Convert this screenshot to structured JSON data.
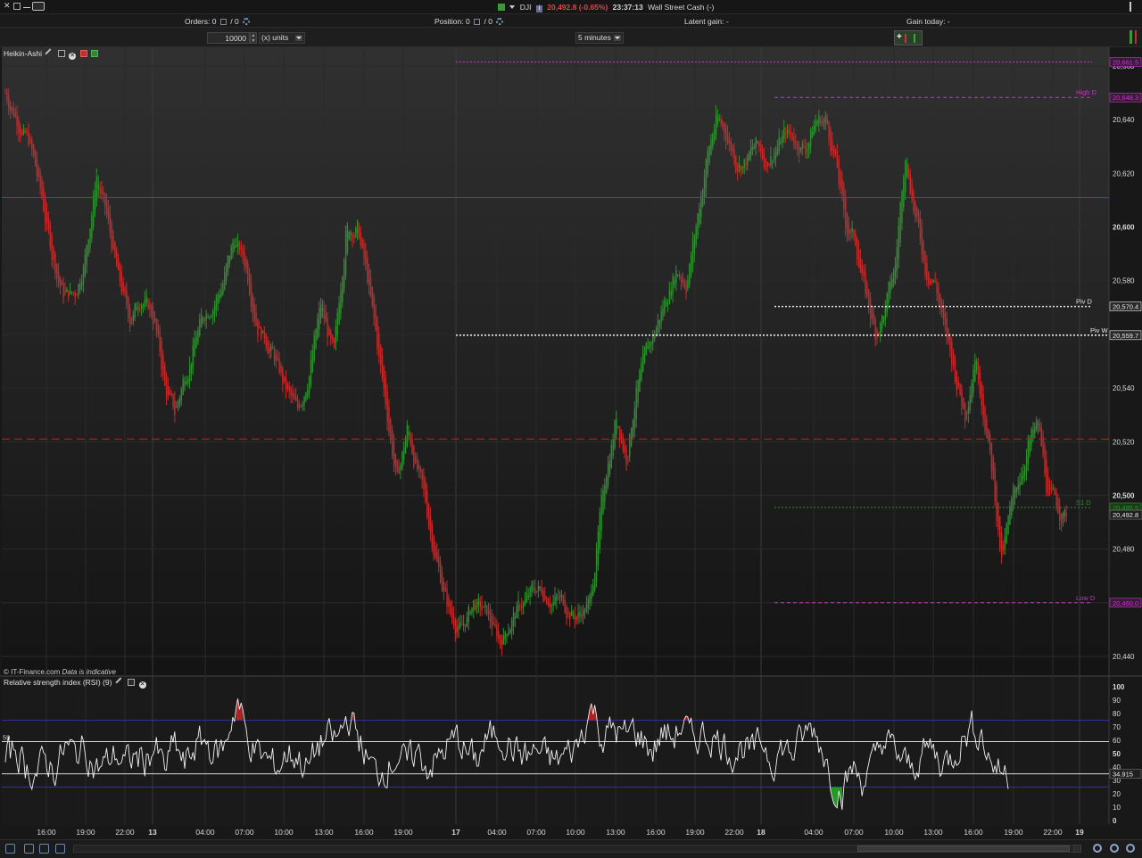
{
  "window": {
    "symbol": "DJI",
    "price_change": "20,492.8 (-0.65%)",
    "time": "23:37:13",
    "instrument": "Wall Street Cash (-)"
  },
  "infobar": {
    "orders_label": "Orders:",
    "orders_count": "0",
    "orders_pending": "0",
    "position_label": "Position:",
    "position_count": "0",
    "position_pending": "0",
    "latent_gain_label": "Latent gain:",
    "latent_gain_value": "-",
    "gain_today_label": "Gain today:",
    "gain_today_value": "-"
  },
  "toolbar": {
    "quantity": "10000",
    "units": "(x) units",
    "interval": "5 minutes"
  },
  "main_panel": {
    "title": "Heikin-Ashi",
    "credit": "© IT-Finance.com",
    "credit_note": "Data is indicative"
  },
  "rsi_panel": {
    "title": "Relative strength index (RSI) (9)",
    "level_left": "59",
    "current_value": "34.915"
  },
  "colors": {
    "up": "#2f8f2f",
    "down": "#c42a2a",
    "magenta": "#c03cc0",
    "red_line": "#c02020",
    "white_dotted": "#e8e8e8",
    "rsi_line": "#f0f0f0",
    "rsi_band": "#3030a0"
  },
  "chart_data": [
    {
      "type": "candlestick",
      "title": "Heikin-Ashi",
      "y_ticks": [
        "20,440",
        "20,460",
        "20,480",
        "20,500",
        "20,520",
        "20,540",
        "20,560",
        "20,580",
        "20,600",
        "20,620",
        "20,640",
        "20,660"
      ],
      "ylim": [
        20433,
        20665
      ],
      "x_ticks": [
        "16:00",
        "19:00",
        "22:00",
        "13",
        "04:00",
        "07:00",
        "10:00",
        "13:00",
        "16:00",
        "19:00",
        "17",
        "04:00",
        "07:00",
        "10:00",
        "13:00",
        "16:00",
        "19:00",
        "22:00",
        "18",
        "04:00",
        "07:00",
        "10:00",
        "13:00",
        "16:00",
        "19:00",
        "22:00",
        "19"
      ],
      "levels": [
        {
          "label": "",
          "value": 20661.5,
          "value_label": "20,661.5",
          "style": "dotted",
          "color": "magenta"
        },
        {
          "label": "High D",
          "value": 20648.3,
          "value_label": "20,648.3",
          "style": "dashed",
          "color": "magenta"
        },
        {
          "label": "",
          "value": 20611,
          "value_label": "",
          "style": "solid",
          "color": "red"
        },
        {
          "label": "Piv D",
          "value": 20570.4,
          "value_label": "20,570.4",
          "style": "dotted",
          "color": "white"
        },
        {
          "label": "Piv W",
          "value": 20559.7,
          "value_label": "20,559.7",
          "style": "dotted",
          "color": "white"
        },
        {
          "label": "",
          "value": 20521,
          "value_label": "",
          "style": "dashed",
          "color": "red"
        },
        {
          "label": "S1 D",
          "value": 20495.5,
          "value_label": "20,495.5",
          "style": "dotted",
          "color": "green"
        },
        {
          "label": "Low D",
          "value": 20460.0,
          "value_label": "20,460.0",
          "style": "dashed",
          "color": "magenta"
        }
      ],
      "last_price": "20,492.8",
      "anchors": [
        [
          0,
          20650
        ],
        [
          8,
          20640
        ],
        [
          15,
          20630
        ],
        [
          22,
          20610
        ],
        [
          28,
          20590
        ],
        [
          35,
          20575
        ],
        [
          42,
          20575
        ],
        [
          48,
          20590
        ],
        [
          55,
          20620
        ],
        [
          62,
          20600
        ],
        [
          68,
          20580
        ],
        [
          75,
          20565
        ],
        [
          82,
          20575
        ],
        [
          90,
          20565
        ],
        [
          96,
          20540
        ],
        [
          102,
          20530
        ],
        [
          108,
          20545
        ],
        [
          115,
          20560
        ],
        [
          122,
          20570
        ],
        [
          130,
          20578
        ],
        [
          138,
          20595
        ],
        [
          145,
          20585
        ],
        [
          152,
          20565
        ],
        [
          160,
          20555
        ],
        [
          168,
          20540
        ],
        [
          176,
          20530
        ],
        [
          182,
          20545
        ],
        [
          190,
          20570
        ],
        [
          198,
          20550
        ],
        [
          205,
          20600
        ],
        [
          212,
          20600
        ],
        [
          218,
          20580
        ],
        [
          224,
          20555
        ],
        [
          230,
          20530
        ],
        [
          236,
          20505
        ],
        [
          242,
          20525
        ],
        [
          248,
          20510
        ],
        [
          255,
          20490
        ],
        [
          262,
          20470
        ],
        [
          268,
          20455
        ],
        [
          275,
          20450
        ],
        [
          282,
          20460
        ],
        [
          290,
          20455
        ],
        [
          298,
          20445
        ],
        [
          305,
          20455
        ],
        [
          312,
          20460
        ],
        [
          320,
          20465
        ],
        [
          328,
          20463
        ],
        [
          336,
          20460
        ],
        [
          344,
          20455
        ],
        [
          352,
          20460
        ],
        [
          356,
          20480
        ],
        [
          362,
          20510
        ],
        [
          368,
          20530
        ],
        [
          374,
          20515
        ],
        [
          380,
          20540
        ],
        [
          388,
          20555
        ],
        [
          396,
          20570
        ],
        [
          404,
          20585
        ],
        [
          410,
          20580
        ],
        [
          416,
          20600
        ],
        [
          422,
          20625
        ],
        [
          428,
          20640
        ],
        [
          434,
          20635
        ],
        [
          440,
          20625
        ],
        [
          446,
          20625
        ],
        [
          452,
          20630
        ],
        [
          458,
          20625
        ],
        [
          464,
          20630
        ],
        [
          470,
          20635
        ],
        [
          476,
          20632
        ],
        [
          482,
          20630
        ],
        [
          488,
          20640
        ],
        [
          494,
          20640
        ],
        [
          500,
          20625
        ],
        [
          506,
          20600
        ],
        [
          512,
          20595
        ],
        [
          518,
          20575
        ],
        [
          524,
          20560
        ],
        [
          530,
          20570
        ],
        [
          536,
          20585
        ],
        [
          542,
          20630
        ],
        [
          548,
          20605
        ],
        [
          554,
          20585
        ],
        [
          560,
          20580
        ],
        [
          566,
          20560
        ],
        [
          572,
          20545
        ],
        [
          578,
          20530
        ],
        [
          584,
          20555
        ],
        [
          590,
          20530
        ],
        [
          596,
          20500
        ],
        [
          600,
          20475
        ],
        [
          604,
          20490
        ],
        [
          610,
          20505
        ],
        [
          616,
          20520
        ],
        [
          622,
          20525
        ],
        [
          628,
          20500
        ],
        [
          634,
          20495
        ],
        [
          640,
          20492.8
        ]
      ]
    },
    {
      "type": "line",
      "title": "Relative strength index (RSI) (9)",
      "y_ticks": [
        "0",
        "10",
        "20",
        "30",
        "40",
        "50",
        "60",
        "70",
        "80",
        "90",
        "100"
      ],
      "ylim": [
        0,
        100
      ],
      "bands": [
        25,
        75
      ],
      "guide_levels": [
        59,
        34.915
      ],
      "anchors": [
        [
          0,
          45
        ],
        [
          6,
          55
        ],
        [
          12,
          40
        ],
        [
          18,
          35
        ],
        [
          24,
          45
        ],
        [
          30,
          38
        ],
        [
          36,
          55
        ],
        [
          42,
          50
        ],
        [
          48,
          55
        ],
        [
          54,
          38
        ],
        [
          60,
          42
        ],
        [
          66,
          50
        ],
        [
          72,
          42
        ],
        [
          78,
          48
        ],
        [
          84,
          45
        ],
        [
          90,
          55
        ],
        [
          96,
          38
        ],
        [
          102,
          58
        ],
        [
          108,
          40
        ],
        [
          114,
          55
        ],
        [
          120,
          60
        ],
        [
          126,
          50
        ],
        [
          132,
          55
        ],
        [
          136,
          75
        ],
        [
          140,
          90
        ],
        [
          146,
          60
        ],
        [
          152,
          50
        ],
        [
          158,
          45
        ],
        [
          164,
          40
        ],
        [
          170,
          50
        ],
        [
          176,
          48
        ],
        [
          182,
          38
        ],
        [
          188,
          55
        ],
        [
          194,
          62
        ],
        [
          200,
          60
        ],
        [
          206,
          78
        ],
        [
          212,
          65
        ],
        [
          218,
          45
        ],
        [
          224,
          35
        ],
        [
          230,
          40
        ],
        [
          236,
          48
        ],
        [
          242,
          42
        ],
        [
          248,
          52
        ],
        [
          254,
          40
        ],
        [
          260,
          45
        ],
        [
          266,
          55
        ],
        [
          272,
          62
        ],
        [
          278,
          50
        ],
        [
          284,
          45
        ],
        [
          290,
          60
        ],
        [
          296,
          66
        ],
        [
          302,
          58
        ],
        [
          308,
          52
        ],
        [
          314,
          48
        ],
        [
          320,
          52
        ],
        [
          326,
          48
        ],
        [
          332,
          44
        ],
        [
          338,
          50
        ],
        [
          344,
          55
        ],
        [
          350,
          75
        ],
        [
          354,
          85
        ],
        [
          360,
          60
        ],
        [
          366,
          70
        ],
        [
          372,
          62
        ],
        [
          378,
          68
        ],
        [
          384,
          60
        ],
        [
          390,
          52
        ],
        [
          396,
          66
        ],
        [
          402,
          62
        ],
        [
          408,
          72
        ],
        [
          414,
          60
        ],
        [
          420,
          65
        ],
        [
          426,
          62
        ],
        [
          432,
          58
        ],
        [
          438,
          50
        ],
        [
          444,
          55
        ],
        [
          450,
          50
        ],
        [
          456,
          60
        ],
        [
          462,
          44
        ],
        [
          468,
          55
        ],
        [
          474,
          50
        ],
        [
          480,
          62
        ],
        [
          486,
          70
        ],
        [
          492,
          55
        ],
        [
          498,
          30
        ],
        [
          504,
          20
        ],
        [
          510,
          40
        ],
        [
          516,
          30
        ],
        [
          522,
          40
        ],
        [
          528,
          60
        ],
        [
          534,
          55
        ],
        [
          540,
          45
        ],
        [
          546,
          38
        ],
        [
          552,
          50
        ],
        [
          558,
          55
        ],
        [
          564,
          42
        ],
        [
          570,
          48
        ],
        [
          576,
          60
        ],
        [
          582,
          70
        ],
        [
          588,
          65
        ],
        [
          592,
          48
        ],
        [
          598,
          38
        ],
        [
          604,
          35
        ]
      ]
    }
  ]
}
